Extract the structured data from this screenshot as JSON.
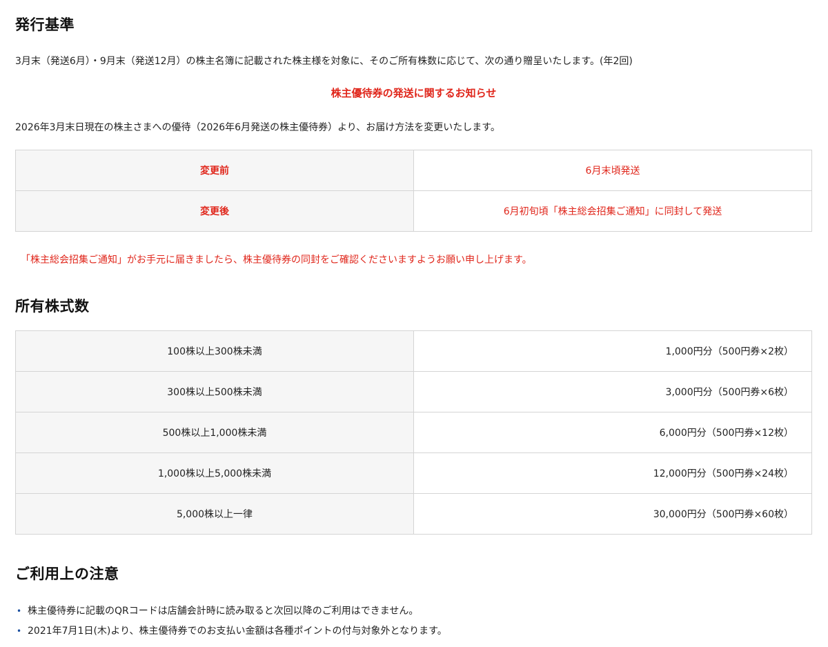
{
  "issue_criteria": {
    "heading": "発行基準",
    "text": "3月末（発送6月）・9月末（発送12月）の株主名簿に記載された株主様を対象に、そのご所有株数に応じて、次の通り贈呈いたします。(年2回)"
  },
  "notice": {
    "title": "株主優待券の発送に関するお知らせ",
    "intro": "2026年3月末日現在の株主さまへの優待（2026年6月発送の株主優待券）より、お届け方法を変更いたします。",
    "table": [
      {
        "label": "変更前",
        "value": "6月末頃発送"
      },
      {
        "label": "変更後",
        "value": "6月初旬頃「株主総会招集ご通知」に同封して発送"
      }
    ],
    "note": "「株主総会招集ご通知」がお手元に届きましたら、株主優待券の同封をご確認くださいますようお願い申し上げます。"
  },
  "shares": {
    "heading": "所有株式数",
    "rows": [
      {
        "range": "100株以上300株未満",
        "benefit": "1,000円分（500円券×2枚）"
      },
      {
        "range": "300株以上500株未満",
        "benefit": "3,000円分（500円券×6枚）"
      },
      {
        "range": "500株以上1,000株未満",
        "benefit": "6,000円分（500円券×12枚）"
      },
      {
        "range": "1,000株以上5,000株未満",
        "benefit": "12,000円分（500円券×24枚）"
      },
      {
        "range": "5,000株以上一律",
        "benefit": "30,000円分（500円券×60枚）"
      }
    ]
  },
  "usage_notes": {
    "heading": "ご利用上の注意",
    "bullet": "•",
    "items": [
      "株主優待券に記載のQRコードは店舗会計時に読み取ると次回以降のご利用はできません。",
      "2021年7月1日(木)より、株主優待券でのお支払い金額は各種ポイントの付与対象外となります。"
    ]
  },
  "colors": {
    "accent_red": "#e0261b",
    "label_cell_bg": "#f6f6f6",
    "border": "#d4d4d4",
    "bullet": "#1a4fa0"
  }
}
